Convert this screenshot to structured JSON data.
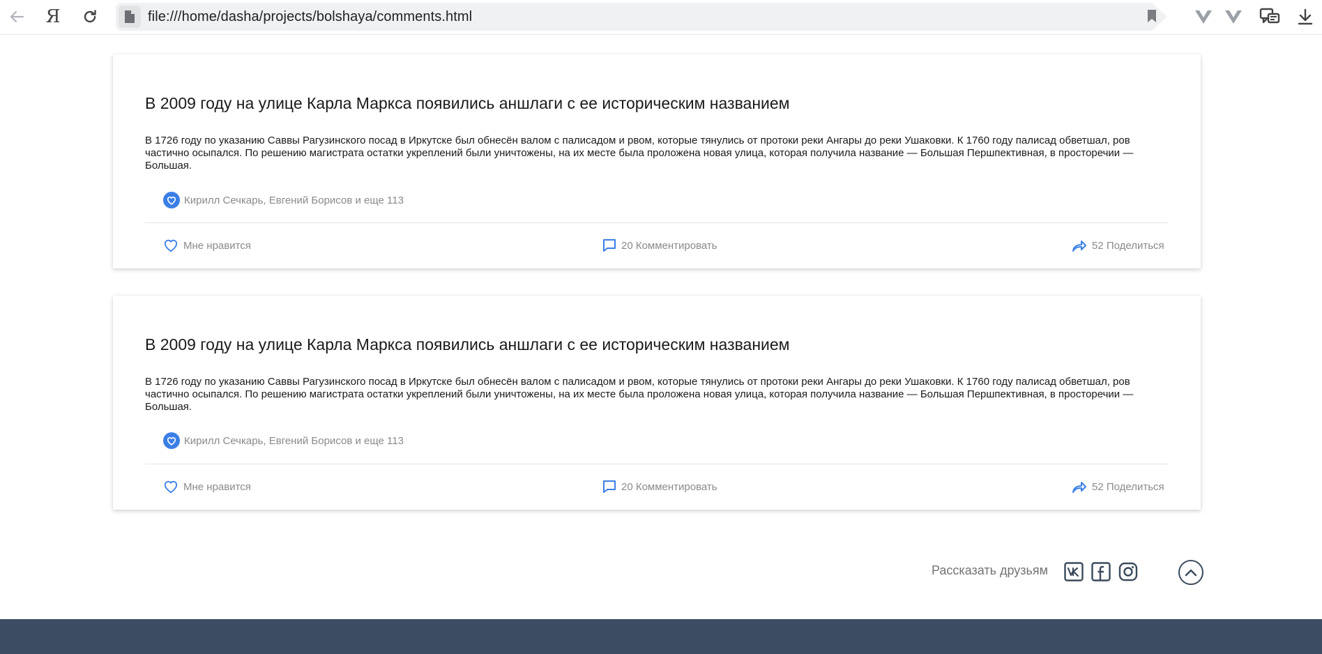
{
  "browser": {
    "url": "file:///home/dasha/projects/bolshaya/comments.html",
    "back_icon": "arrow-left-icon",
    "yandex_label": "Я",
    "reload_icon": "reload-icon"
  },
  "posts": [
    {
      "title": "В 2009 году на улице Карла Маркса появились аншлаги с ее историческим названием",
      "text": "В 1726 году по указанию Саввы Рагузинского посад в Иркутске был обнесён валом с палисадом и рвом, которые тянулись от протоки реки Ангары до реки Ушаковки. К 1760 году палисад обветшал, ров частично осыпался. По решению магистрата остатки укреплений были уничтожены, на их месте была проложена новая улица, которая получила название — Большая Першпективная, в просторечии — Большая.",
      "likes_summary": "Кирилл Сечкарь, Евгений Борисов и еще 113",
      "like_label": "Мне нравится",
      "comment_label": "20 Комментировать",
      "share_label": "52 Поделиться"
    },
    {
      "title": "В 2009 году на улице Карла Маркса появились аншлаги с ее историческим названием",
      "text": "В 1726 году по указанию Саввы Рагузинского посад в Иркутске был обнесён валом с палисадом и рвом, которые тянулись от протоки реки Ангары до реки Ушаковки. К 1760 году палисад обветшал, ров частично осыпался. По решению магистрата остатки укреплений были уничтожены, на их месте была проложена новая улица, которая получила название — Большая Першпективная, в просторечии — Большая.",
      "likes_summary": "Кирилл Сечкарь, Евгений Борисов и еще 113",
      "like_label": "Мне нравится",
      "comment_label": "20 Комментировать",
      "share_label": "52 Поделиться"
    }
  ],
  "footer": {
    "share_friends_label": "Рассказать друзьям",
    "socials": [
      "vk-icon",
      "facebook-icon",
      "instagram-icon"
    ],
    "scroll_top_icon": "chevron-up-icon"
  },
  "colors": {
    "accent": "#3b7fe6",
    "muted_text": "#8a8a8a",
    "footer_band": "#3c4c62"
  }
}
